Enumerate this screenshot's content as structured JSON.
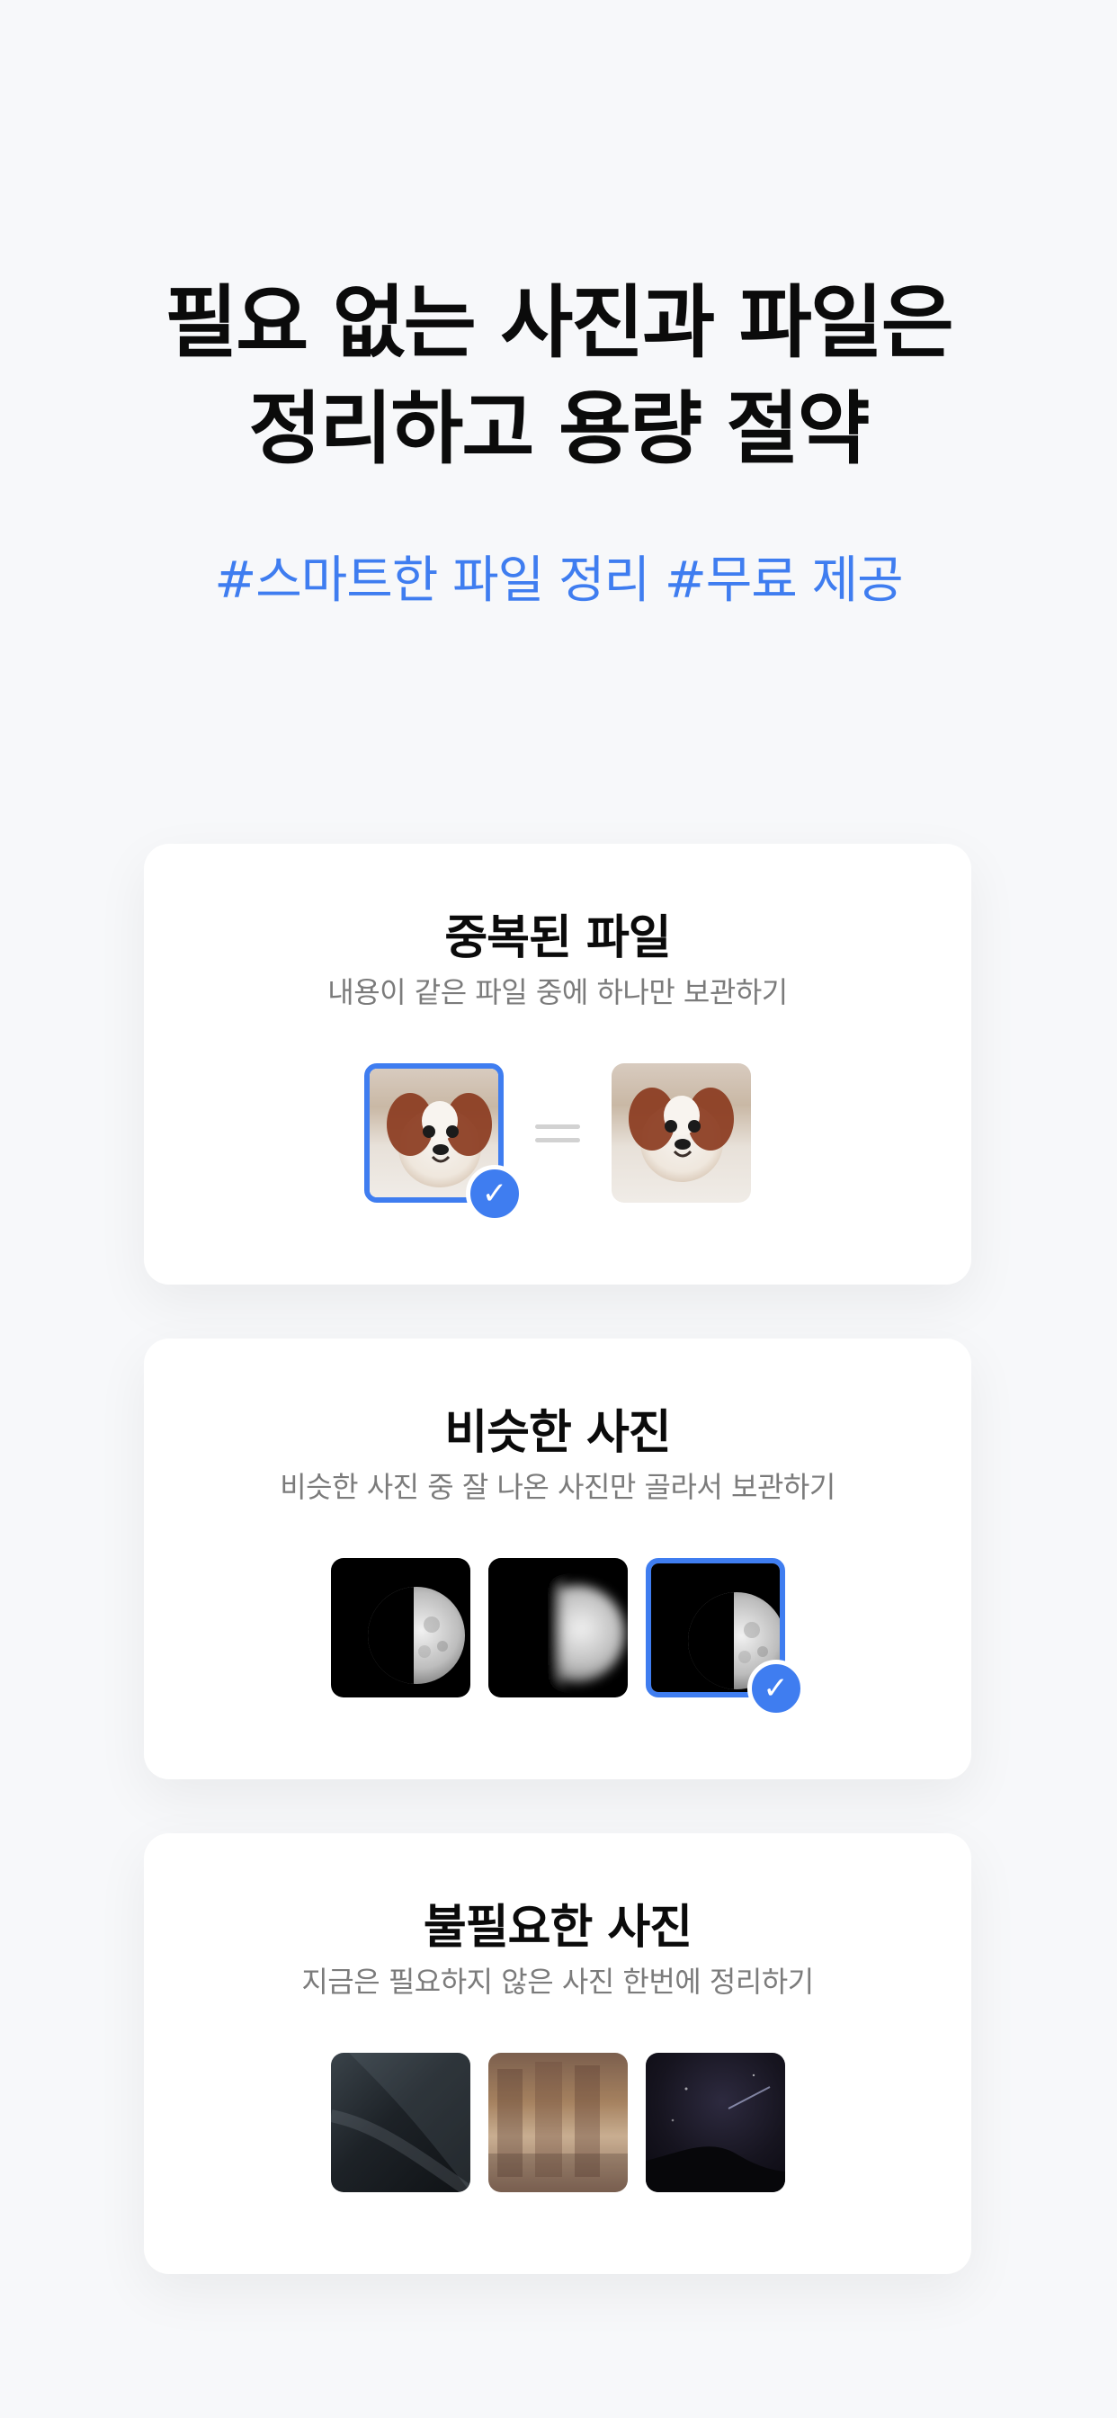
{
  "hero": {
    "title": "필요 없는 사진과 파일은\n정리하고 용량 절약",
    "hashtags": "#스마트한 파일 정리 #무료 제공"
  },
  "cards": [
    {
      "title": "중복된 파일",
      "subtitle": "내용이 같은 파일 중에 하나만 보관하기",
      "thumb_labels": [
        "puppy-photo",
        "puppy-photo"
      ]
    },
    {
      "title": "비슷한 사진",
      "subtitle": "비슷한 사진 중 잘 나온 사진만 골라서 보관하기",
      "thumb_labels": [
        "moon-photo",
        "moon-photo-blurry",
        "moon-photo"
      ]
    },
    {
      "title": "불필요한 사진",
      "subtitle": "지금은 필요하지 않은 사진 한번에 정리하기",
      "thumb_labels": [
        "blurry-photo",
        "library-photo",
        "night-sky-photo"
      ]
    }
  ],
  "colors": {
    "accent": "#3f7df0",
    "background": "#f7f8fa",
    "card": "#ffffff",
    "subtitle": "#7b7b7b"
  },
  "icons": {
    "check": "check-icon",
    "equal": "equal-icon"
  }
}
